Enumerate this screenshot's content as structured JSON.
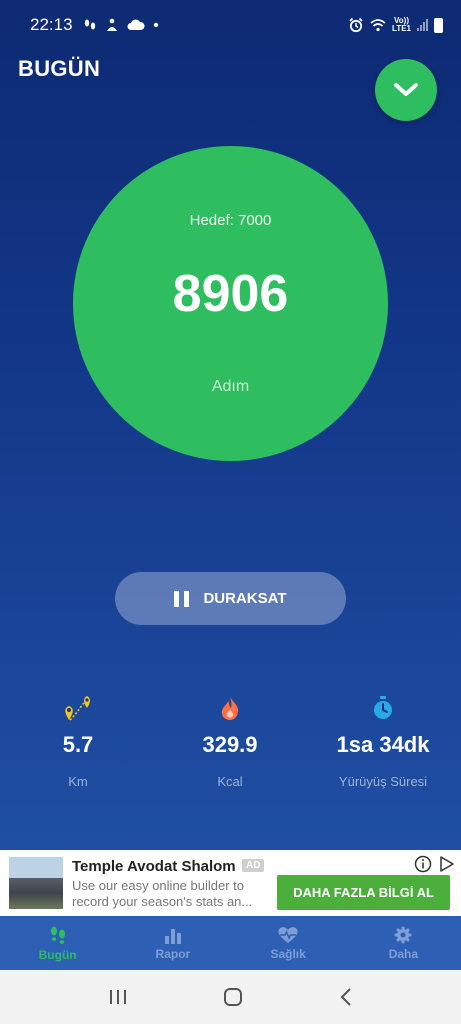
{
  "status_bar": {
    "time": "22:13",
    "network": "LTE1",
    "voice": "Vo))"
  },
  "header": {
    "title": "BUGÜN"
  },
  "step_counter": {
    "goal_text": "Hedef: 7000",
    "steps": "8906",
    "unit": "Adım",
    "circle_color": "#2ebd5f"
  },
  "pause_button": {
    "label": "DURAKSAT"
  },
  "stats": [
    {
      "icon": "location-pins-icon",
      "value": "5.7",
      "label": "Km",
      "icon_color": "#f2c420"
    },
    {
      "icon": "flame-icon",
      "value": "329.9",
      "label": "Kcal",
      "icon_color": "#ff7043"
    },
    {
      "icon": "stopwatch-icon",
      "value": "1sa 34dk",
      "label": "Yürüyüş Süresi",
      "icon_color": "#29a9e8"
    }
  ],
  "ad": {
    "title": "Temple Avodat Shalom",
    "badge": "AD",
    "description": "Use our easy online builder to record your season's stats an...",
    "cta": "DAHA FAZLA BİLGİ AL"
  },
  "tabs": [
    {
      "label": "Bugün",
      "icon": "footsteps-icon",
      "active": true
    },
    {
      "label": "Rapor",
      "icon": "bar-chart-icon",
      "active": false
    },
    {
      "label": "Sağlık",
      "icon": "heart-pulse-icon",
      "active": false
    },
    {
      "label": "Daha",
      "icon": "gear-icon",
      "active": false
    }
  ],
  "colors": {
    "accent_green": "#2ebd5f",
    "background_top": "#0d2a73",
    "tab_bar": "#2d5fb4",
    "cta_green": "#4caf3c"
  }
}
